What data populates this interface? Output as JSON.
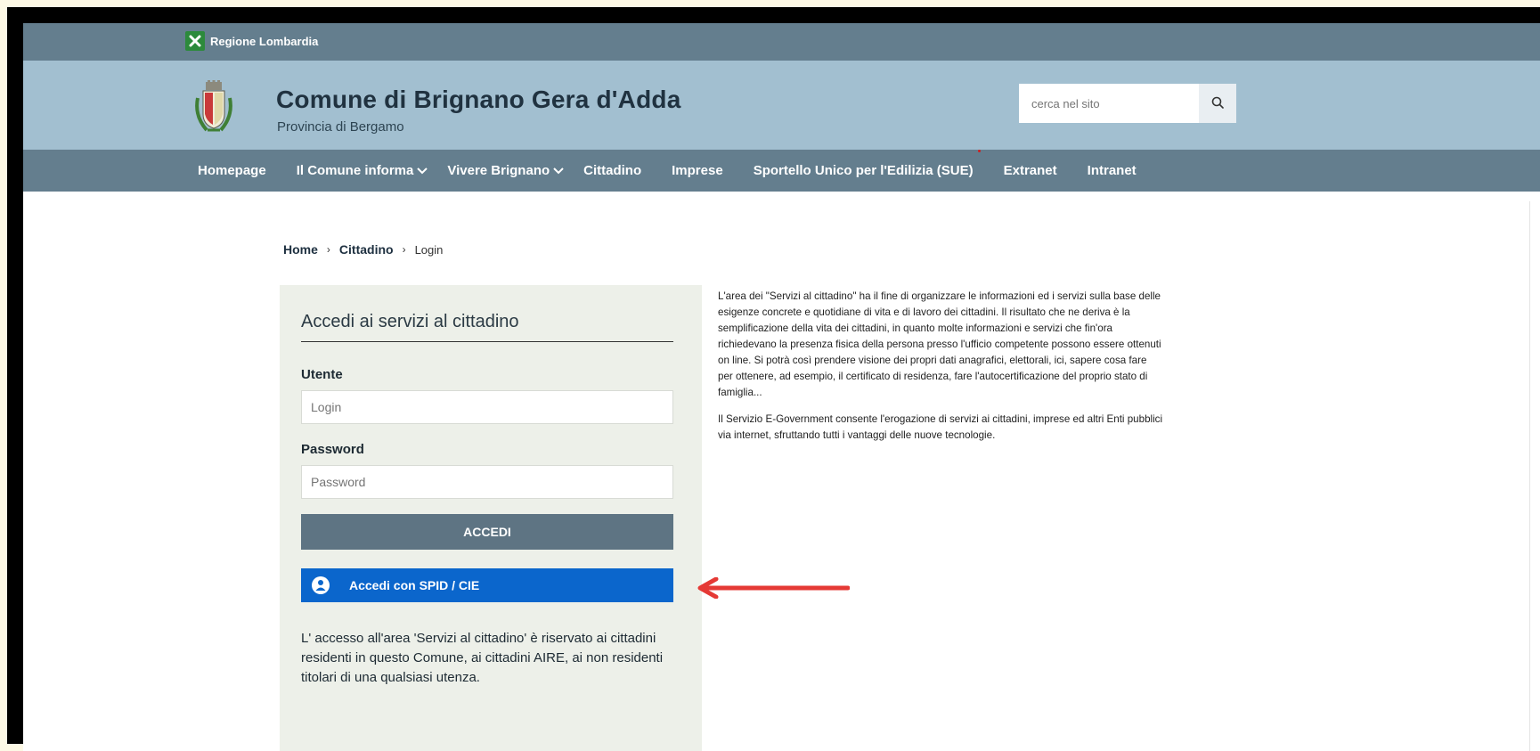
{
  "region": {
    "label": "Regione Lombardia"
  },
  "header": {
    "title": "Comune di Brignano Gera d'Adda",
    "subtitle": "Provincia di Bergamo",
    "search_placeholder": "cerca nel sito"
  },
  "nav": {
    "items": [
      {
        "label": "Homepage"
      },
      {
        "label": "Il Comune informa",
        "has_submenu": true
      },
      {
        "label": "Vivere Brignano",
        "has_submenu": true
      },
      {
        "label": "Cittadino"
      },
      {
        "label": "Imprese"
      },
      {
        "label": "Sportello Unico per l'Edilizia (SUE)"
      },
      {
        "label": "Extranet"
      },
      {
        "label": "Intranet"
      }
    ]
  },
  "breadcrumb": {
    "home": "Home",
    "section": "Cittadino",
    "current": "Login",
    "separator": "›"
  },
  "login": {
    "title": "Accedi ai servizi al cittadino",
    "user_label": "Utente",
    "user_placeholder": "Login",
    "password_label": "Password",
    "password_placeholder": "Password",
    "submit_label": "ACCEDI",
    "spid_label": "Accedi con SPID / CIE",
    "note": "L' accesso all'area 'Servizi al cittadino' è riservato ai cittadini residenti in questo Comune, ai cittadini AIRE, ai non residenti titolari di una qualsiasi utenza."
  },
  "info": {
    "paragraph1": "L'area dei \"Servizi al cittadino\" ha il fine di organizzare le informazioni ed i servizi sulla base delle esigenze concrete e quotidiane di vita e di lavoro dei cittadini. Il risultato che ne deriva è la semplificazione della vita dei cittadini, in quanto molte informazioni e servizi che fin'ora richiedevano la presenza fisica della persona presso l'ufficio competente possono essere ottenuti on line. Si potrà così prendere visione dei propri dati anagrafici, elettorali, ici, sapere cosa fare per ottenere, ad esempio, il certificato di residenza, fare l'autocertificazione del proprio stato di famiglia...",
    "paragraph2": "Il Servizio E-Government consente l'erogazione di servizi ai cittadini, imprese ed altri Enti pubblici via internet, sfruttando tutti i vantaggi delle nuove tecnologie."
  },
  "colors": {
    "nav_bg": "#647e8e",
    "header_bg": "#a2bfd0",
    "spid_blue": "#0b66cc",
    "annotation_arrow": "#e53935"
  },
  "icons": {
    "search": "search-icon",
    "chevron": "chevron-down-icon",
    "user": "user-icon",
    "region_logo": "lombardia-logo-icon",
    "crest": "municipal-crest-icon"
  }
}
